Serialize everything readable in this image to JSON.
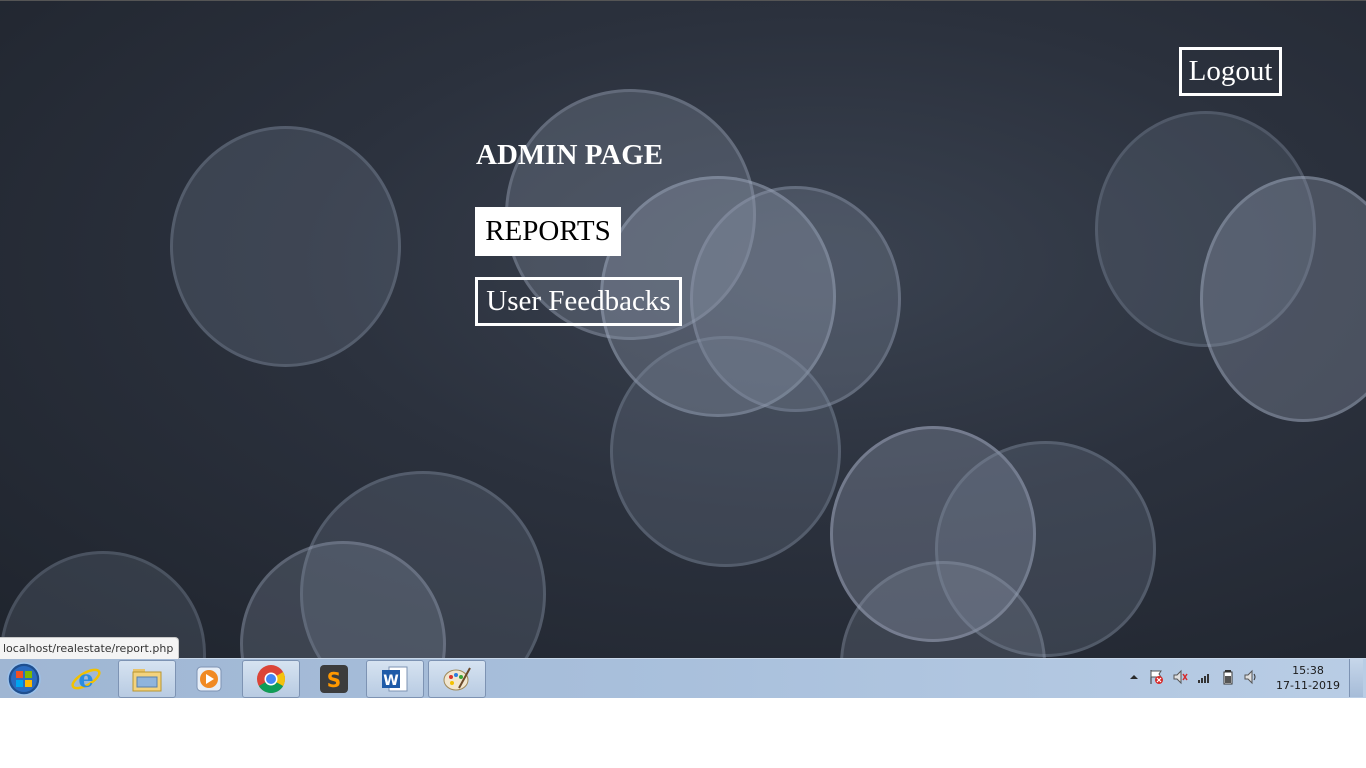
{
  "page": {
    "title": "ADMIN PAGE",
    "logout_label": "Logout",
    "reports_label": "REPORTS",
    "feedback_label": "User Feedbacks"
  },
  "status_bar": {
    "url": "localhost/realestate/report.php"
  },
  "taskbar": {
    "items": [
      {
        "icon": "windows-start-icon"
      },
      {
        "icon": "internet-explorer-icon"
      },
      {
        "icon": "file-explorer-icon"
      },
      {
        "icon": "media-player-icon"
      },
      {
        "icon": "chrome-icon"
      },
      {
        "icon": "sublime-text-icon"
      },
      {
        "icon": "word-icon"
      },
      {
        "icon": "paint-icon"
      }
    ],
    "clock": {
      "time": "15:38",
      "date": "17-11-2019"
    }
  },
  "colors": {
    "background": "#2b313d",
    "foreground": "#ffffff",
    "taskbar": "#a9c0dc"
  }
}
